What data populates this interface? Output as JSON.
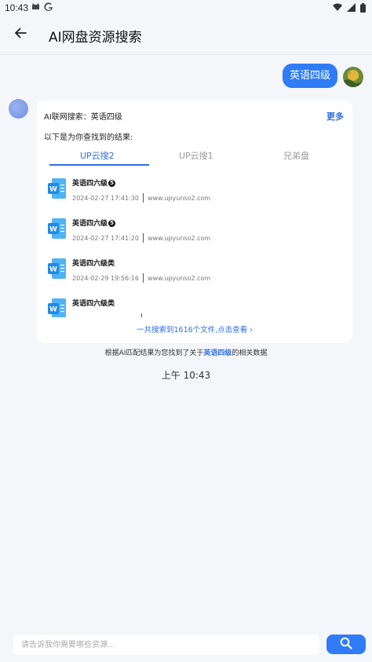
{
  "status_bar": {
    "time": "10:43",
    "left_icons": [
      "cat-icon",
      "google-icon"
    ],
    "right_icons": [
      "wifi-icon",
      "signal-icon",
      "battery-icon"
    ]
  },
  "header": {
    "title": "AI网盘资源搜索",
    "back_icon": "arrow-left-icon"
  },
  "user_message": {
    "text": "英语四级"
  },
  "result_card": {
    "query_label": "AI联网搜索：英语四级",
    "more_label": "更多",
    "subtitle": "以下是为你查找到的结果:",
    "tabs": [
      {
        "label": "UP云搜2",
        "active": true
      },
      {
        "label": "UP云搜1",
        "active": false
      },
      {
        "label": "兄弟盘",
        "active": false
      }
    ],
    "files": [
      {
        "name": "英语四六级",
        "badge": "5",
        "date": "2024-02-27 17:41:30",
        "source": "www.upyunso2.com"
      },
      {
        "name": "英语四六级",
        "badge": "5",
        "date": "2024-02-27 17:41:20",
        "source": "www.upyunso2.com"
      },
      {
        "name": "英语四六级类",
        "badge": "",
        "date": "2024-02-29 19:56:16",
        "source": "www.upyunso2.com"
      },
      {
        "name": "英语四六级类",
        "badge": "",
        "date": "",
        "source": ""
      }
    ],
    "footer": "一共搜索到1616个文件,点击查看 ›"
  },
  "summary": {
    "prefix": "根据AI匹配结果为您找到了关于",
    "highlight": "英语四级",
    "suffix": "的相关数据"
  },
  "timestamp": "上午 10:43",
  "input": {
    "placeholder": "请告诉我你需要哪些资源...",
    "value": ""
  },
  "colors": {
    "accent": "#2f7cf6",
    "link": "#2f6fe0",
    "background": "#f4f6fa"
  }
}
